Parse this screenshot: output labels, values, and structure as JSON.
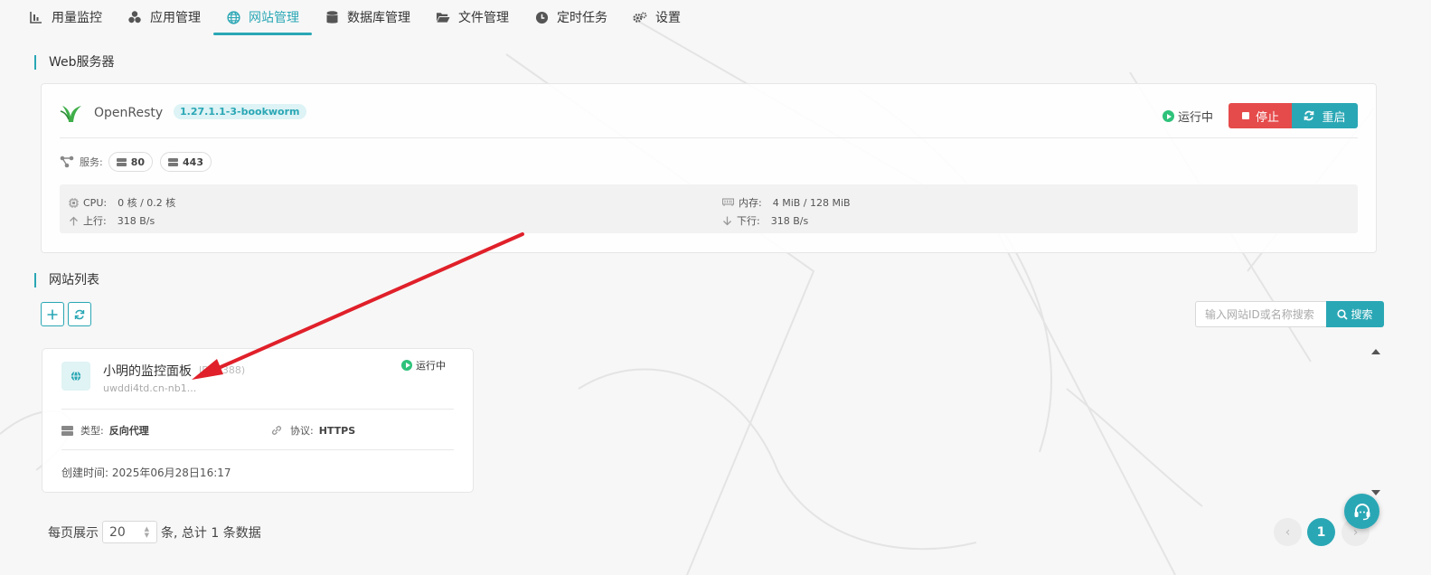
{
  "nav": {
    "tabs": [
      {
        "label": "用量监控",
        "icon": "bar-chart-icon"
      },
      {
        "label": "应用管理",
        "icon": "cubes-icon"
      },
      {
        "label": "网站管理",
        "icon": "globe-icon",
        "active": true
      },
      {
        "label": "数据库管理",
        "icon": "database-icon"
      },
      {
        "label": "文件管理",
        "icon": "folder-open-icon"
      },
      {
        "label": "定时任务",
        "icon": "clock-icon"
      },
      {
        "label": "设置",
        "icon": "gears-icon"
      }
    ]
  },
  "web_server": {
    "section_title": "Web服务器",
    "name": "OpenResty",
    "version": "1.27.1.1-3-bookworm",
    "status": "运行中",
    "stop_label": "停止",
    "restart_label": "重启",
    "services_label": "服务:",
    "ports": [
      "80",
      "443"
    ],
    "cpu_label": "CPU:",
    "cpu_value": "0 核 / 0.2 核",
    "mem_label": "内存:",
    "mem_value": "4 MiB / 128 MiB",
    "up_label": "上行:",
    "up_value": "318 B/s",
    "down_label": "下行:",
    "down_value": "318 B/s"
  },
  "site_list": {
    "section_title": "网站列表",
    "search_placeholder": "输入网站ID或名称搜索",
    "search_label": "搜索",
    "sites": [
      {
        "name": "小明的监控面板",
        "id_text": "ID: 1388)",
        "domain": "uwddi4td.cn-nb1...",
        "status": "运行中",
        "type_label": "类型:",
        "type_value": "反向代理",
        "protocol_label": "协议:",
        "protocol_value": "HTTPS",
        "created": "创建时间: 2025年06月28日16:17"
      }
    ]
  },
  "pagination": {
    "per_page_label": "每页展示",
    "page_size": "20",
    "total_text": "条, 总计 1 条数据",
    "current_page": "1"
  },
  "colors": {
    "accent": "#2aa7b5",
    "danger": "#e64b4b",
    "running": "#2ec27a",
    "annotation_arrow": "#e0202a"
  }
}
